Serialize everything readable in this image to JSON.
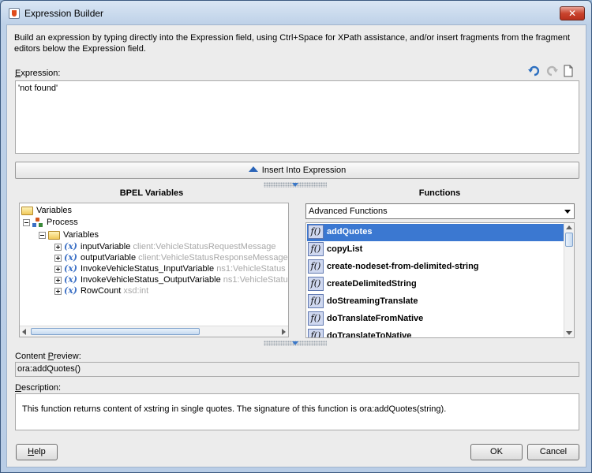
{
  "window": {
    "title": "Expression Builder",
    "close_glyph": "✕"
  },
  "intro_text": "Build an expression by typing directly into the Expression field, using Ctrl+Space for XPath assistance, and/or insert fragments from the fragment editors below the Expression field.",
  "expression": {
    "label_mnemonic": "E",
    "label_rest": "xpression:",
    "value": "'not found'"
  },
  "toolbar": {
    "icons": [
      "undo-icon",
      "redo-icon",
      "clear-icon"
    ]
  },
  "insert_button_label": "Insert Into Expression",
  "bpel_variables": {
    "heading": "BPEL Variables",
    "tree": [
      {
        "label": "Variables",
        "type": "",
        "icon": "folder-icon",
        "level": 0,
        "expander": "none"
      },
      {
        "label": "Process",
        "type": "",
        "icon": "process-icon",
        "level": 1,
        "expander": "minus"
      },
      {
        "label": "Variables",
        "type": "",
        "icon": "folder-icon",
        "level": 2,
        "expander": "minus"
      },
      {
        "label": "inputVariable",
        "type": "client:VehicleStatusRequestMessage",
        "icon": "variable-icon",
        "level": 3,
        "expander": "plus"
      },
      {
        "label": "outputVariable",
        "type": "client:VehicleStatusResponseMessage",
        "icon": "variable-icon",
        "level": 3,
        "expander": "plus"
      },
      {
        "label": "InvokeVehicleStatus_InputVariable",
        "type": "ns1:VehicleStatus",
        "icon": "variable-icon",
        "level": 3,
        "expander": "plus"
      },
      {
        "label": "InvokeVehicleStatus_OutputVariable",
        "type": "ns1:VehicleStatu",
        "icon": "variable-icon",
        "level": 3,
        "expander": "plus"
      },
      {
        "label": "RowCount",
        "type": "xsd:int",
        "icon": "variable-icon",
        "level": 3,
        "expander": "plus"
      }
    ]
  },
  "functions": {
    "heading": "Functions",
    "category": "Advanced Functions",
    "icon_text": "f()",
    "items": [
      {
        "name": "addQuotes",
        "selected": true
      },
      {
        "name": "copyList",
        "selected": false
      },
      {
        "name": "create-nodeset-from-delimited-string",
        "selected": false
      },
      {
        "name": "createDelimitedString",
        "selected": false
      },
      {
        "name": "doStreamingTranslate",
        "selected": false
      },
      {
        "name": "doTranslateFromNative",
        "selected": false
      },
      {
        "name": "doTranslateToNative",
        "selected": false
      }
    ]
  },
  "content_preview": {
    "label_pre": "Content ",
    "label_mnemonic": "P",
    "label_rest": "review:",
    "value": "ora:addQuotes()"
  },
  "description": {
    "label_mnemonic": "D",
    "label_rest": "escription:",
    "text": "This function returns content of xstring in single quotes. The signature of this function is ora:addQuotes(string)."
  },
  "buttons": {
    "help_mnemonic": "H",
    "help_rest": "elp",
    "ok": "OK",
    "cancel": "Cancel"
  },
  "colors": {
    "selection": "#3b78d1",
    "accent_blue": "#2a64b8",
    "close_red": "#c9442e"
  }
}
